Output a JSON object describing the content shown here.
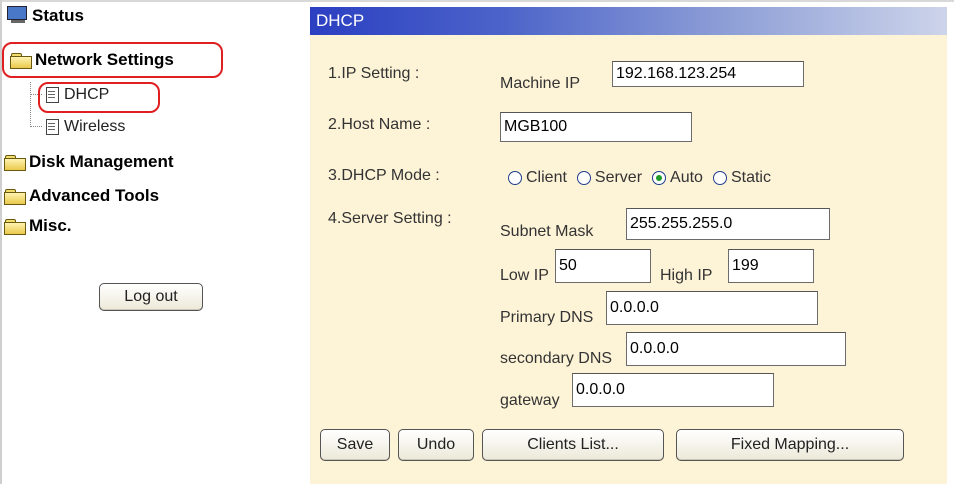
{
  "sidebar": {
    "items": [
      {
        "label": "Status",
        "icon": "monitor-icon"
      },
      {
        "label": "Network Settings",
        "icon": "folder-open-icon"
      },
      {
        "label": "DHCP",
        "icon": "page-icon"
      },
      {
        "label": "Wireless",
        "icon": "page-icon"
      },
      {
        "label": "Disk Management",
        "icon": "folder-icon"
      },
      {
        "label": "Advanced Tools",
        "icon": "folder-icon"
      },
      {
        "label": "Misc.",
        "icon": "folder-icon"
      }
    ],
    "logout_label": "Log out"
  },
  "panel": {
    "title": "DHCP",
    "ip_setting": {
      "label": "1.IP Setting :",
      "machine_ip_label": "Machine IP",
      "machine_ip_value": "192.168.123.254"
    },
    "host_name": {
      "label": "2.Host Name :",
      "value": "MGB100"
    },
    "dhcp_mode": {
      "label": "3.DHCP Mode :",
      "options": [
        "Client",
        "Server",
        "Auto",
        "Static"
      ],
      "selected": "Auto"
    },
    "server_setting": {
      "label": "4.Server Setting :",
      "subnet_mask_label": "Subnet Mask",
      "subnet_mask_value": "255.255.255.0",
      "low_ip_label": "Low IP",
      "low_ip_value": "50",
      "high_ip_label": "High IP",
      "high_ip_value": "199",
      "primary_dns_label": "Primary DNS",
      "primary_dns_value": "0.0.0.0",
      "secondary_dns_label": "secondary DNS",
      "secondary_dns_value": "0.0.0.0",
      "gateway_label": "gateway",
      "gateway_value": "0.0.0.0"
    },
    "buttons": {
      "save": "Save",
      "undo": "Undo",
      "clients_list": "Clients List...",
      "fixed_mapping": "Fixed Mapping..."
    }
  },
  "colors": {
    "title_bar_start": "#2b3fc2",
    "panel_bg": "#fdf3d7",
    "highlight": "#e02020",
    "radio_selected": "#1f9a2a"
  }
}
